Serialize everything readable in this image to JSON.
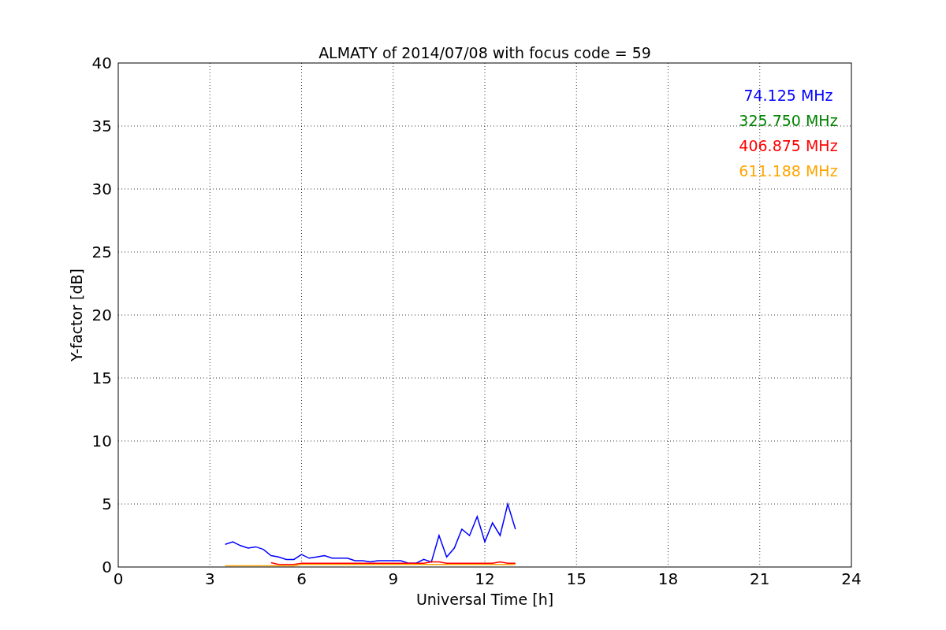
{
  "chart_data": {
    "type": "line",
    "title": "ALMATY of 2014/07/08 with focus code = 59",
    "xlabel": "Universal Time [h]",
    "ylabel": "Y-factor [dB]",
    "x": [
      3.5,
      3.75,
      4.0,
      4.25,
      4.5,
      4.75,
      5.0,
      5.25,
      5.5,
      5.75,
      6.0,
      6.25,
      6.5,
      6.75,
      7.0,
      7.25,
      7.5,
      7.75,
      8.0,
      8.25,
      8.5,
      8.75,
      9.0,
      9.25,
      9.5,
      9.75,
      10.0,
      10.25,
      10.5,
      10.75,
      11.0,
      11.25,
      11.5,
      11.75,
      12.0,
      12.25,
      12.5,
      12.75,
      13.0
    ],
    "series": [
      {
        "name": "74.125 MHz",
        "color": "#0000ff",
        "values": [
          1.8,
          2.0,
          1.7,
          1.5,
          1.6,
          1.4,
          0.9,
          0.8,
          0.6,
          0.6,
          1.0,
          0.7,
          0.8,
          0.9,
          0.7,
          0.7,
          0.7,
          0.5,
          0.5,
          0.4,
          0.5,
          0.5,
          0.5,
          0.5,
          0.3,
          0.3,
          0.6,
          0.4,
          2.5,
          0.8,
          1.5,
          3.0,
          2.5,
          4.0,
          2.0,
          3.5,
          2.5,
          5.0,
          3.0
        ]
      },
      {
        "name": "325.750 MHz",
        "color": "#008000",
        "values": [
          null,
          null,
          null,
          null,
          null,
          null,
          null,
          null,
          null,
          null,
          null,
          null,
          null,
          null,
          null,
          null,
          null,
          null,
          null,
          null,
          null,
          null,
          null,
          null,
          null,
          null,
          null,
          null,
          null,
          null,
          null,
          null,
          null,
          null,
          null,
          null,
          null,
          null,
          null
        ]
      },
      {
        "name": "406.875 MHz",
        "color": "#ff0000",
        "values": [
          null,
          null,
          null,
          null,
          null,
          null,
          0.35,
          0.2,
          0.2,
          0.2,
          0.3,
          0.3,
          0.3,
          0.3,
          0.3,
          0.3,
          0.3,
          0.3,
          0.3,
          0.3,
          0.3,
          0.3,
          0.3,
          0.3,
          0.3,
          0.3,
          0.3,
          0.4,
          0.4,
          0.3,
          0.3,
          0.3,
          0.3,
          0.3,
          0.3,
          0.3,
          0.4,
          0.3,
          0.3
        ]
      },
      {
        "name": "611.188 MHz",
        "color": "#ffa500",
        "values": [
          0.1,
          0.1,
          0.1,
          0.1,
          0.1,
          0.1,
          0.1,
          0.1,
          0.1,
          0.1,
          0.2,
          0.2,
          0.2,
          0.2,
          0.2,
          0.2,
          0.2,
          0.2,
          0.2,
          0.2,
          0.2,
          0.2,
          0.2,
          0.2,
          0.2,
          0.2,
          0.2,
          0.2,
          0.2,
          0.2,
          0.2,
          0.2,
          0.2,
          0.2,
          0.2,
          0.2,
          0.2,
          0.2,
          0.2
        ]
      }
    ],
    "grid": true,
    "xlim": [
      0,
      24
    ],
    "ylim": [
      0,
      40
    ],
    "xticks": [
      0,
      3,
      6,
      9,
      12,
      15,
      18,
      21,
      24
    ],
    "yticks": [
      0,
      5,
      10,
      15,
      20,
      25,
      30,
      35,
      40
    ]
  }
}
